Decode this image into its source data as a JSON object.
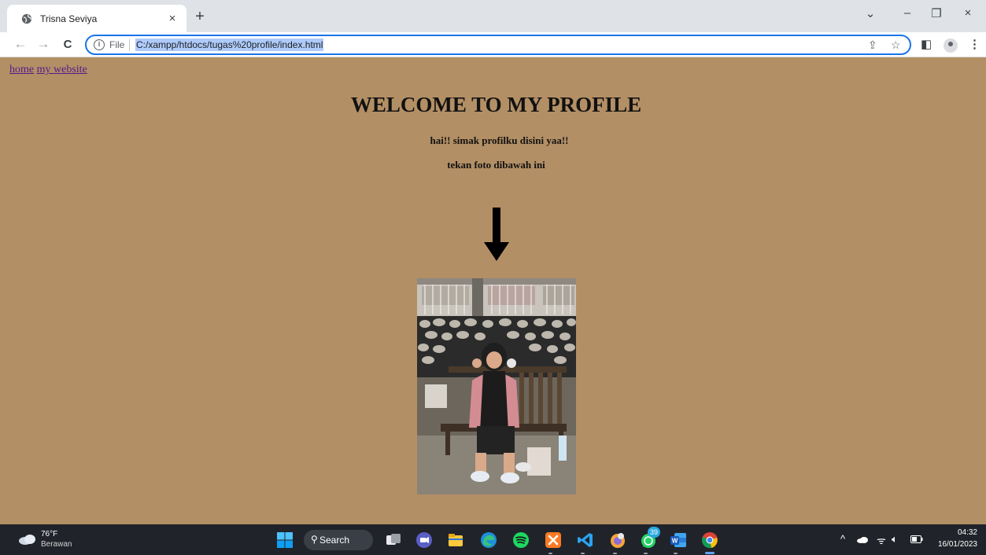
{
  "browser": {
    "tab_title": "Trisna Seviya",
    "tab_close": "×",
    "new_tab": "+",
    "window_controls": {
      "dropdown": "⌄",
      "minimize": "–",
      "restore": "❐",
      "close": "×"
    },
    "nav": {
      "back": "←",
      "forward": "→",
      "reload": "C"
    },
    "address": {
      "scheme_label": "File",
      "url": "C:/xampp/htdocs/tugas%20profile/index.html"
    }
  },
  "page": {
    "nav_links": [
      "home",
      "my website"
    ],
    "heading": "WELCOME TO MY PROFILE",
    "subtitle": "hai!! simak profilku disini yaa!!",
    "instruction": "tekan foto dibawah ini",
    "background_color": "#b38f65"
  },
  "taskbar": {
    "weather": {
      "temp": "76°F",
      "condition": "Berawan"
    },
    "search_label": "Search",
    "whatsapp_badge": "39",
    "clock": {
      "time": "04:32",
      "date": "16/01/2023"
    },
    "pinned_icons": [
      "windows-start-icon",
      "search-icon",
      "task-view-icon",
      "meet-icon",
      "file-explorer-icon",
      "edge-icon",
      "spotify-icon",
      "xampp-icon",
      "vscode-icon",
      "app-icon",
      "whatsapp-icon",
      "word-icon",
      "chrome-icon"
    ]
  }
}
